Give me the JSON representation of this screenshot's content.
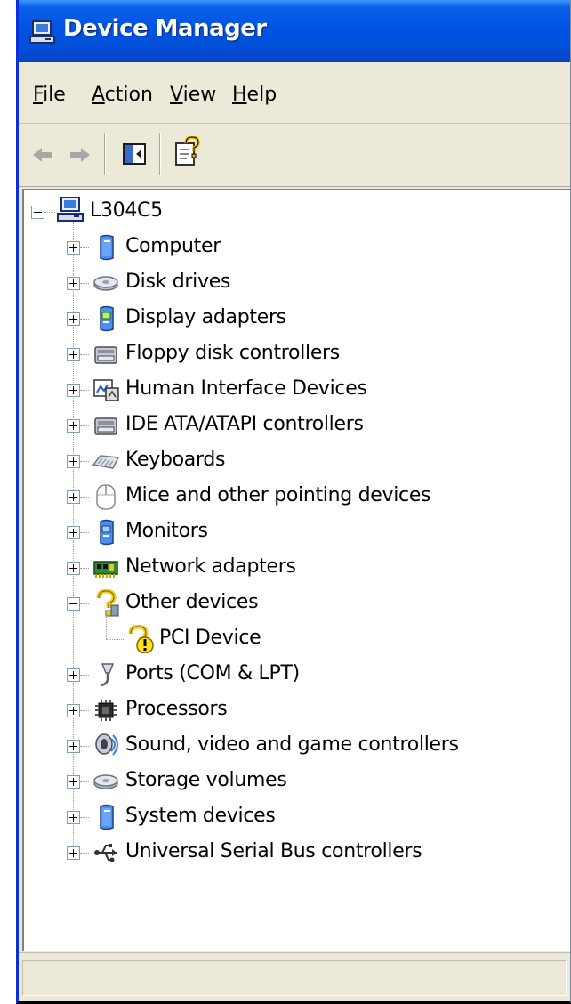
{
  "window": {
    "title": "Device Manager"
  },
  "menu": [
    "File",
    "Action",
    "View",
    "Help"
  ],
  "toolbar": {
    "buttons": [
      "back-icon",
      "forward-icon",
      "show-hide-console-tree-icon",
      "help-icon"
    ]
  },
  "tree": {
    "root": "L304C5",
    "items": [
      {
        "label": "Computer",
        "icon": "computer-icon",
        "expanded": false
      },
      {
        "label": "Disk drives",
        "icon": "disk-drive-icon",
        "expanded": false
      },
      {
        "label": "Display adapters",
        "icon": "display-adapter-icon",
        "expanded": false
      },
      {
        "label": "Floppy disk controllers",
        "icon": "floppy-controller-icon",
        "expanded": false
      },
      {
        "label": "Human Interface Devices",
        "icon": "hid-icon",
        "expanded": false
      },
      {
        "label": "IDE ATA/ATAPI controllers",
        "icon": "ide-controller-icon",
        "expanded": false
      },
      {
        "label": "Keyboards",
        "icon": "keyboard-icon",
        "expanded": false
      },
      {
        "label": "Mice and other pointing devices",
        "icon": "mouse-icon",
        "expanded": false
      },
      {
        "label": "Monitors",
        "icon": "monitor-icon",
        "expanded": false
      },
      {
        "label": "Network adapters",
        "icon": "network-adapter-icon",
        "expanded": false
      },
      {
        "label": "Other devices",
        "icon": "unknown-device-icon",
        "expanded": true,
        "children": [
          {
            "label": "PCI Device",
            "icon": "warning-unknown-device-icon"
          }
        ]
      },
      {
        "label": "Ports (COM & LPT)",
        "icon": "port-icon",
        "expanded": false
      },
      {
        "label": "Processors",
        "icon": "processor-icon",
        "expanded": false
      },
      {
        "label": "Sound, video and game controllers",
        "icon": "sound-icon",
        "expanded": false
      },
      {
        "label": "Storage volumes",
        "icon": "storage-volume-icon",
        "expanded": false
      },
      {
        "label": "System devices",
        "icon": "system-device-icon",
        "expanded": false
      },
      {
        "label": "Universal Serial Bus controllers",
        "icon": "usb-icon",
        "expanded": false
      }
    ]
  },
  "colors": {
    "titlebar": "#0054e3",
    "chrome": "#ece9d8",
    "tree_bg": "#ffffff"
  }
}
